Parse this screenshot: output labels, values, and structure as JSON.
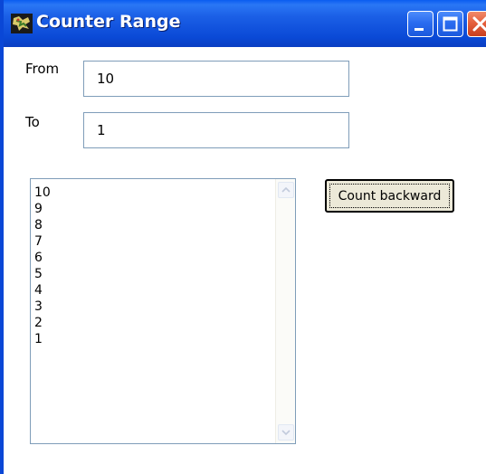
{
  "window": {
    "title": "Counter Range",
    "accent_color": "#0a47d6",
    "close_color": "#e5603d"
  },
  "form": {
    "from_label": "From",
    "from_value": "10",
    "to_label": "To",
    "to_value": "1"
  },
  "list": {
    "items": [
      "10",
      "9",
      "8",
      "7",
      "6",
      "5",
      "4",
      "3",
      "2",
      "1"
    ]
  },
  "actions": {
    "count_backward_label": "Count backward"
  },
  "icons": {
    "app": "app-icon",
    "minimize": "minimize-icon",
    "maximize": "maximize-icon",
    "close": "close-icon",
    "scroll_up": "chevron-up-icon",
    "scroll_down": "chevron-down-icon"
  }
}
